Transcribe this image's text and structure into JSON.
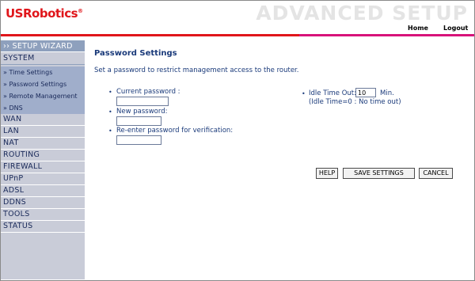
{
  "header": {
    "logo_text": "USRobotics",
    "logo_mark": "®",
    "title": "ADVANCED SETUP",
    "nav": {
      "home": "Home",
      "logout": "Logout"
    },
    "accent_colors": {
      "red": "#e0161b",
      "pink": "#d8127a"
    }
  },
  "sidebar": {
    "wizard": "›› SETUP WIZARD",
    "system": "SYSTEM",
    "sub_items": [
      "» Time Settings",
      "» Password Settings",
      "» Remote Management",
      "» DNS"
    ],
    "items": [
      "WAN",
      "LAN",
      "NAT",
      "ROUTING",
      "FIREWALL",
      "UPnP",
      "ADSL",
      "DDNS",
      "TOOLS",
      "STATUS"
    ]
  },
  "main": {
    "title": "Password Settings",
    "description": "Set a password to restrict management access to the router.",
    "fields": {
      "current_password": {
        "label": "Current password :",
        "value": ""
      },
      "new_password": {
        "label": "New password:",
        "value": ""
      },
      "reenter_password": {
        "label": "Re-enter password for verification:",
        "value": ""
      }
    },
    "idle": {
      "label": "Idle Time Out:",
      "value": "10",
      "unit": "Min.",
      "note": "(Idle Time=0 : No time out)"
    },
    "bullet": "•",
    "buttons": {
      "help": "HELP",
      "save": "SAVE SETTINGS",
      "cancel": "CANCEL"
    }
  }
}
